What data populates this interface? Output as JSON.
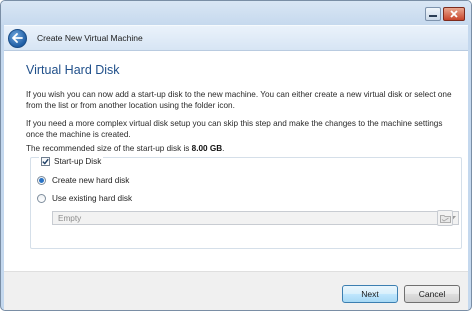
{
  "window": {
    "title": "Create New Virtual Machine"
  },
  "page": {
    "heading": "Virtual Hard Disk",
    "paragraph1": "If you wish you can now add a start-up disk to the new machine. You can either create a new virtual disk or select one from the list or from another location using the folder icon.",
    "paragraph2": "If you need a more complex virtual disk setup you can skip this step and make the changes to the machine settings once the machine is created.",
    "recommended_prefix": "The recommended size of the start-up disk is ",
    "recommended_size": "8.00 GB",
    "recommended_suffix": "."
  },
  "startup_disk": {
    "label": "Start-up Disk",
    "checked": true,
    "options": [
      {
        "label": "Create new hard disk",
        "selected": true
      },
      {
        "label": "Use existing hard disk",
        "selected": false
      }
    ],
    "existing_disk_value": "Empty"
  },
  "buttons": {
    "next": "Next",
    "cancel": "Cancel"
  },
  "icons": {
    "back": "back-arrow-icon",
    "minimize": "minimize-icon",
    "close": "close-icon",
    "dropdown": "chevron-down-icon",
    "folder": "folder-icon"
  },
  "colors": {
    "heading": "#1f4f8a",
    "frame": "#c4d8ee",
    "radio_selected": "#2a73c5"
  }
}
